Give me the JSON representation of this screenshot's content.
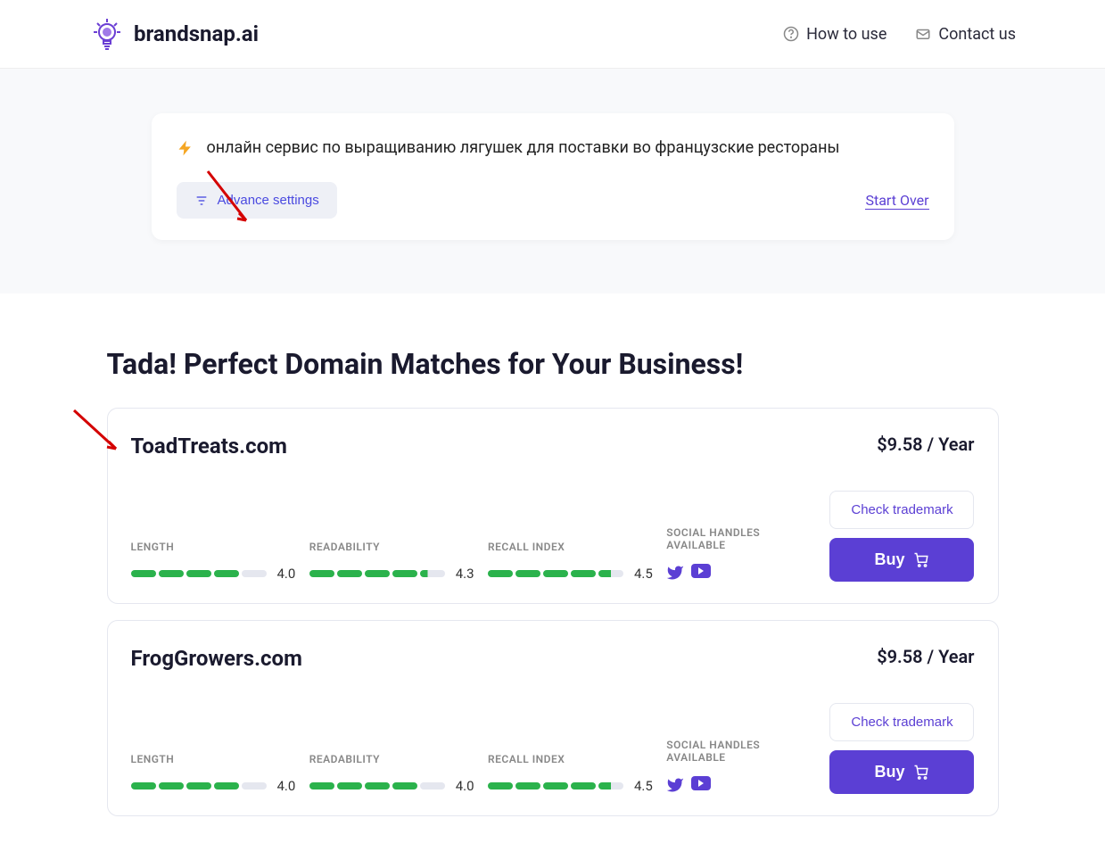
{
  "header": {
    "brand": "brandsnap.ai",
    "nav": {
      "howto": "How to use",
      "contact": "Contact us"
    }
  },
  "search": {
    "query": "онлайн сервис по выращиванию лягушек для поставки во французские рестораны",
    "advance_label": "Advance settings",
    "start_over": "Start Over"
  },
  "results": {
    "title": "Tada! Perfect Domain Matches for Your Business!",
    "labels": {
      "length": "LENGTH",
      "readability": "READABILITY",
      "recall": "RECALL INDEX",
      "social": "SOCIAL HANDLES AVAILABLE",
      "trademark": "Check trademark",
      "buy": "Buy"
    },
    "items": [
      {
        "name": "ToadTreats.com",
        "price": "$9.58 / Year",
        "length": {
          "score": "4.0",
          "fill": 4
        },
        "readability": {
          "score": "4.3",
          "fill": 4
        },
        "recall": {
          "score": "4.5",
          "fill": 4
        }
      },
      {
        "name": "FrogGrowers.com",
        "price": "$9.58 / Year",
        "length": {
          "score": "4.0",
          "fill": 4
        },
        "readability": {
          "score": "4.0",
          "fill": 4
        },
        "recall": {
          "score": "4.5",
          "fill": 4
        }
      }
    ]
  }
}
